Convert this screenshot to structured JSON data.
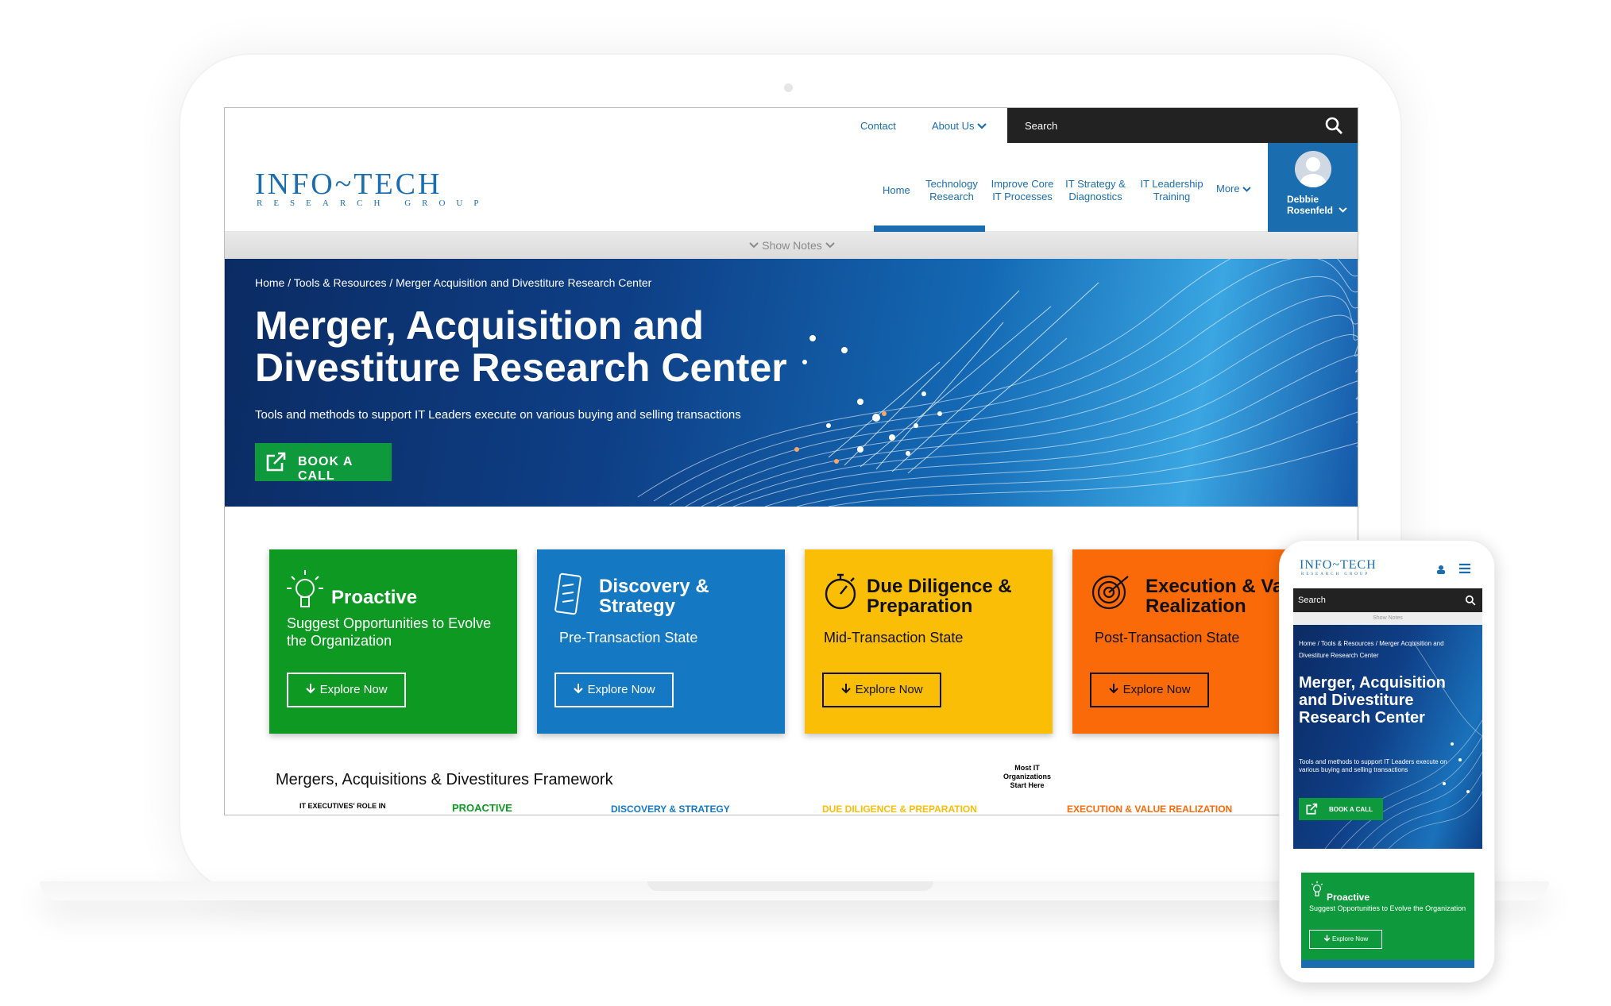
{
  "utility_nav": {
    "contact": "Contact",
    "about": "About Us",
    "search_label": "Search"
  },
  "logo": {
    "main": "INFO~TECH",
    "sub": "RESEARCH GROUP"
  },
  "main_nav": [
    {
      "label": "Home"
    },
    {
      "label": "Technology Research"
    },
    {
      "label": "Improve Core IT Processes"
    },
    {
      "label": "IT Strategy & Diagnostics"
    },
    {
      "label": "IT Leadership Training"
    },
    {
      "label": "More"
    }
  ],
  "user": {
    "name": "Debbie Rosenfeld"
  },
  "show_notes": "Show Notes",
  "breadcrumb": "Home / Tools & Resources / Merger Acquisition and Divestiture Research Center",
  "hero": {
    "title": "Merger, Acquisition and Divestiture Research Center",
    "subtitle": "Tools and methods to support IT Leaders execute on various buying and selling transactions",
    "cta": "BOOK A CALL"
  },
  "cards": [
    {
      "title": "Proactive",
      "subtitle": "Suggest Opportunities to Evolve the Organization",
      "button": "Explore Now",
      "color": "#0e9a22"
    },
    {
      "title": "Discovery & Strategy",
      "subtitle": "Pre-Transaction State",
      "button": "Explore Now",
      "color": "#1479c2"
    },
    {
      "title": "Due Diligence & Preparation",
      "subtitle": "Mid-Transaction State",
      "button": "Explore Now",
      "color": "#fbbe07"
    },
    {
      "title": "Execution & Value Realization",
      "subtitle": "Post-Transaction State",
      "button": "Explore Now",
      "color": "#fb6a08"
    }
  ],
  "framework": {
    "heading": "Mergers, Acquisitions & Divestitures Framework",
    "strip_left": "IT EXECUTIVES' ROLE IN",
    "strip_proactive": "PROACTIVE",
    "strip_discovery": "DISCOVERY & STRATEGY",
    "strip_due": "DUE DILIGENCE & PREPARATION",
    "strip_note": "Most IT Organizations Start Here",
    "strip_exec": "EXECUTION & VALUE REALIZATION"
  },
  "phone": {
    "search_label": "Search",
    "show_notes": "Show Notes",
    "breadcrumb": "Home / Tools & Resources / Merger Acquisition and Divestiture Research Center",
    "title": "Merger, Acquisition and Divestiture Research Center",
    "subtitle": "Tools and methods to support IT Leaders execute on various buying and selling transactions",
    "cta": "BOOK A CALL",
    "card_title": "Proactive",
    "card_subtitle": "Suggest Opportunities to Evolve the Organization",
    "card_button": "Explore Now"
  }
}
